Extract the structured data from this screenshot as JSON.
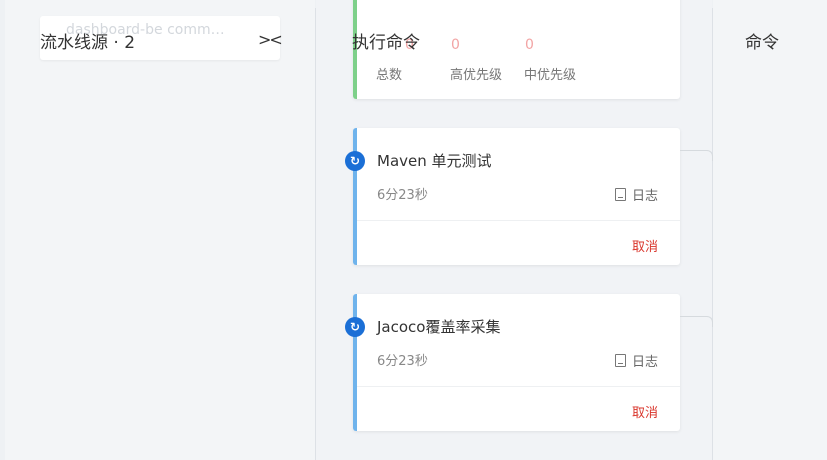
{
  "source_panel": {
    "faded_text": "dashboard-be comm…",
    "title": "流水线源 · 2",
    "collapse_icon": "collapse-icon",
    "collapse_glyph": "><"
  },
  "exec_panel": {
    "title": "执行命令",
    "stats": [
      {
        "label": "总数",
        "value": "0"
      },
      {
        "label": "高优先级",
        "value": "0"
      },
      {
        "label": "中优先级",
        "value": "0"
      }
    ],
    "jobs": [
      {
        "title": "Maven 单元测试",
        "duration": "6分23秒",
        "log_label": "日志",
        "cancel_label": "取消",
        "status_icon": "running-icon"
      },
      {
        "title": "Jacoco覆盖率采集",
        "duration": "6分23秒",
        "log_label": "日志",
        "cancel_label": "取消",
        "status_icon": "running-icon"
      }
    ]
  },
  "cmd_panel": {
    "title": "命令"
  },
  "colors": {
    "accent_blue": "#1b6fd6",
    "bar_green": "#7ed08a",
    "bar_blue": "#6fb3ec",
    "cancel_red": "#d9352b"
  }
}
